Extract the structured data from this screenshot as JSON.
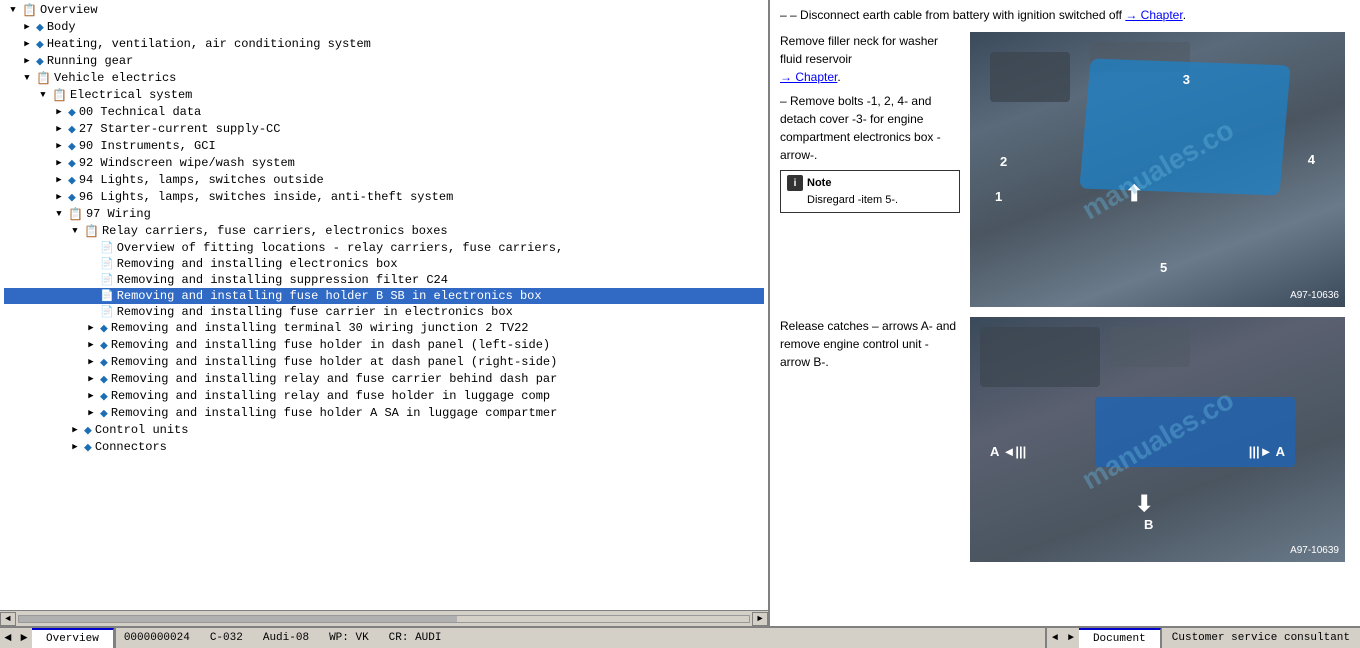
{
  "header": {
    "chapter_link": "Chapter"
  },
  "left_panel": {
    "tree_items": [
      {
        "id": 0,
        "indent": 0,
        "type": "expand",
        "expanded": true,
        "icon": "book",
        "label": "Overview"
      },
      {
        "id": 1,
        "indent": 1,
        "type": "node",
        "expanded": false,
        "icon": "diamond",
        "label": "Body"
      },
      {
        "id": 2,
        "indent": 1,
        "type": "node",
        "expanded": false,
        "icon": "diamond",
        "label": "Heating, ventilation, air conditioning system"
      },
      {
        "id": 3,
        "indent": 1,
        "type": "node",
        "expanded": false,
        "icon": "diamond",
        "label": "Running gear"
      },
      {
        "id": 4,
        "indent": 1,
        "type": "expand",
        "expanded": true,
        "icon": "book",
        "label": "Vehicle electrics"
      },
      {
        "id": 5,
        "indent": 2,
        "type": "expand",
        "expanded": true,
        "icon": "book",
        "label": "Electrical system"
      },
      {
        "id": 6,
        "indent": 3,
        "type": "node",
        "expanded": false,
        "icon": "diamond",
        "label": "00 Technical data"
      },
      {
        "id": 7,
        "indent": 3,
        "type": "node",
        "expanded": false,
        "icon": "diamond",
        "label": "27 Starter-current supply-CC"
      },
      {
        "id": 8,
        "indent": 3,
        "type": "node",
        "expanded": false,
        "icon": "diamond",
        "label": "90 Instruments, GCI"
      },
      {
        "id": 9,
        "indent": 3,
        "type": "node",
        "expanded": false,
        "icon": "diamond",
        "label": "92 Windscreen wipe/wash system"
      },
      {
        "id": 10,
        "indent": 3,
        "type": "node",
        "expanded": false,
        "icon": "diamond",
        "label": "94 Lights, lamps, switches outside"
      },
      {
        "id": 11,
        "indent": 3,
        "type": "node",
        "expanded": false,
        "icon": "diamond",
        "label": "96 Lights, lamps, switches inside, anti-theft system"
      },
      {
        "id": 12,
        "indent": 3,
        "type": "expand",
        "expanded": true,
        "icon": "book",
        "label": "97 Wiring"
      },
      {
        "id": 13,
        "indent": 4,
        "type": "expand",
        "expanded": true,
        "icon": "book",
        "label": "Relay carriers, fuse carriers, electronics boxes"
      },
      {
        "id": 14,
        "indent": 5,
        "type": "doc",
        "label": "Overview of fitting locations - relay carriers, fuse carriers,"
      },
      {
        "id": 15,
        "indent": 5,
        "type": "doc",
        "label": "Removing and installing electronics box",
        "selected": false
      },
      {
        "id": 16,
        "indent": 5,
        "type": "doc",
        "label": "Removing and installing suppression filter C24"
      },
      {
        "id": 17,
        "indent": 5,
        "type": "doc",
        "label": "Removing and installing fuse holder B SB in electronics box",
        "selected": true
      },
      {
        "id": 18,
        "indent": 5,
        "type": "doc",
        "label": "Removing and installing fuse carrier in electronics box"
      },
      {
        "id": 19,
        "indent": 5,
        "type": "node",
        "expanded": false,
        "icon": "diamond",
        "label": "Removing and installing terminal 30 wiring junction 2 TV22"
      },
      {
        "id": 20,
        "indent": 5,
        "type": "node",
        "expanded": false,
        "icon": "diamond",
        "label": "Removing and installing fuse holder in dash panel (left-side)"
      },
      {
        "id": 21,
        "indent": 5,
        "type": "node",
        "expanded": false,
        "icon": "diamond",
        "label": "Removing and installing fuse holder at dash panel (right-side)"
      },
      {
        "id": 22,
        "indent": 5,
        "type": "node",
        "expanded": false,
        "icon": "diamond",
        "label": "Removing and installing relay and fuse carrier behind dash par"
      },
      {
        "id": 23,
        "indent": 5,
        "type": "node",
        "expanded": false,
        "icon": "diamond",
        "label": "Removing and installing relay and fuse holder in luggage comp"
      },
      {
        "id": 24,
        "indent": 5,
        "type": "node",
        "expanded": false,
        "icon": "diamond",
        "label": "Removing and installing fuse holder A SA in luggage compartmer"
      },
      {
        "id": 25,
        "indent": 4,
        "type": "node",
        "expanded": false,
        "icon": "diamond",
        "label": "Control units"
      },
      {
        "id": 26,
        "indent": 4,
        "type": "node",
        "expanded": false,
        "icon": "diamond",
        "label": "Connectors"
      }
    ]
  },
  "right_panel": {
    "instruction1": "– Disconnect earth cable from battery with ignition switched off",
    "chapter_link1": "→ Chapter",
    "instruction2": "Remove filler neck for washer fluid reservoir",
    "chapter_link2": "→ Chapter",
    "instruction3": "Remove bolts -1, 2, 4- and detach cover -3- for engine compartment electronics box -arrow-.",
    "note_label": "Note",
    "note_text": "Disregard -item 5-.",
    "img1_code": "A97-10636",
    "img1_labels": [
      "1",
      "2",
      "3",
      "4",
      "5"
    ],
    "instruction4": "Release catches – arrows A- and remove engine control unit - arrow B-.",
    "img2_code": "A97-10639",
    "img2_labels": [
      "A",
      "A",
      "B"
    ]
  },
  "tabs": {
    "left": "Overview",
    "right": "Document"
  },
  "status_bar": {
    "items": [
      "0000000024",
      "C-032",
      "Audi-08",
      "WP: VK",
      "CR: AUDI"
    ]
  },
  "status_right": "Customer service consultant"
}
